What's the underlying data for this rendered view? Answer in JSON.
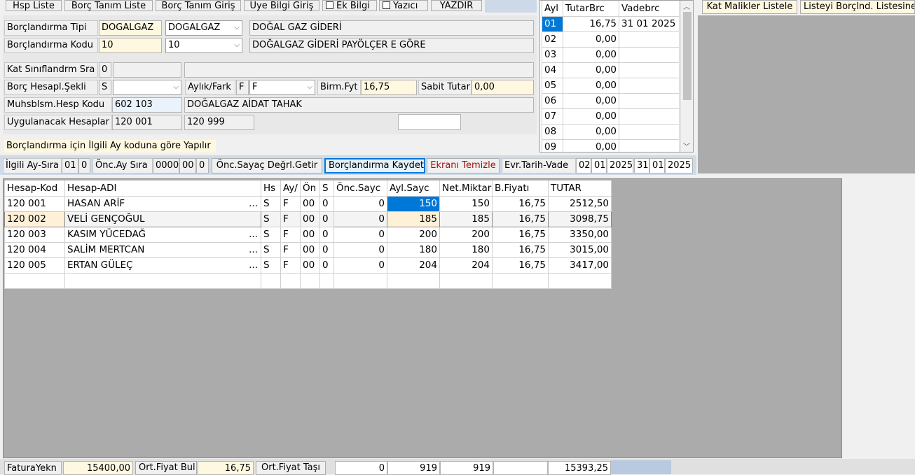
{
  "toolbar": {
    "hsp_liste": "Hsp Liste",
    "borc_tanim_liste": "Borç Tanım Liste",
    "borc_tanim_giris": "Borç Tanım Giriş",
    "uye_bilgi_giris": "Üye Bilgi Giriş",
    "ek_bilgi": "Ek Bilgi",
    "yazici": "Yazıcı",
    "yazdir": "YAZDIR"
  },
  "form": {
    "borc_tipi_label": "Borçlandırma Tipi",
    "borc_tipi_value": "DOGALGAZ",
    "borc_tipi_combo": "DOGALGAZ",
    "borc_tipi_desc": "DOĞAL GAZ GİDERİ",
    "borc_kodu_label": "Borçlandırma Kodu",
    "borc_kodu_value": "10",
    "borc_kodu_combo": "10",
    "borc_kodu_desc": "DOĞALGAZ GİDERİ PAYÖLÇER E GÖRE",
    "kat_sinif_label": "Kat Sınıflandrm Sra",
    "kat_sinif_value": "0",
    "kat_sinif_desc": "",
    "kat_sinif_desc2": "",
    "borc_hesapl_label": "Borç Hesapl.Şekli",
    "borc_hesapl_value": "S",
    "borc_hesapl_combo": "",
    "aylik_fark_label": "Aylık/Fark",
    "aylik_fark_value": "F",
    "aylik_fark_combo": "F",
    "birm_fyt_label": "Birm.Fyt",
    "birm_fyt_value": "16,75",
    "sabit_tutar_label": "Sabit Tutar",
    "sabit_tutar_value": "0,00",
    "muhsb_label": "Muhsblsm.Hesp Kodu",
    "muhsb_value": "602 103",
    "muhsb_desc": "DOĞALGAZ AİDAT TAHAK",
    "uyg_hesap_label": "Uygulanacak Hesaplar",
    "uyg_hesap_from": "120 001",
    "uyg_hesap_to": "120 999",
    "uyg_extra": "",
    "info_text": "Borçlandırma için İlgili Ay koduna göre Yapılır"
  },
  "month_grid": {
    "headers": [
      "Ayl",
      "TutarBrc",
      "Vadebrc"
    ],
    "rows": [
      [
        "01",
        "16,75",
        "31 01 2025"
      ],
      [
        "02",
        "0,00",
        ""
      ],
      [
        "03",
        "0,00",
        ""
      ],
      [
        "04",
        "0,00",
        ""
      ],
      [
        "05",
        "0,00",
        ""
      ],
      [
        "06",
        "0,00",
        ""
      ],
      [
        "07",
        "0,00",
        ""
      ],
      [
        "08",
        "0,00",
        ""
      ],
      [
        "09",
        "0,00",
        ""
      ]
    ]
  },
  "right_buttons": {
    "kat_malikler": "Kat Malikler Listele",
    "listeyi_borclnd": "Listeyi Borçlnd. Listesine"
  },
  "action_bar": {
    "ilgili_ay_label": "İlgili Ay-Sıra",
    "ilgili_ay": "01",
    "ilgili_sira": "0",
    "onc_ay_label": "Önc.Ay Sıra",
    "onc_ay_year": "0000",
    "onc_ay": "00",
    "onc_sira": "0",
    "onc_sayac_btn": "Önc.Sayaç Değrl.Getir",
    "kaydet_btn": "Borçlandırma Kaydet",
    "temizle_btn": "Ekranı Temizle",
    "evr_tarih_label": "Evr.Tarih-Vade",
    "evr_gun": "02",
    "evr_ay": "01",
    "evr_yil": "2025",
    "vade_gun": "31",
    "vade_ay": "01",
    "vade_yil": "2025"
  },
  "main_grid": {
    "headers": [
      "Hesap-Kod",
      "Hesap-ADI",
      "Hs",
      "Ay/",
      "Ön",
      "S",
      "Önc.Sayc",
      "Ayl.Sayc",
      "Net.Miktar",
      "B.Fiyatı",
      "TUTAR"
    ],
    "rows": [
      [
        "120 001",
        "HASAN ARİF",
        "S",
        "F",
        "00",
        "0",
        "0",
        "150",
        "150",
        "16,75",
        "2512,50"
      ],
      [
        "120 002",
        "VELİ GENÇOĞUL",
        "S",
        "F",
        "00",
        "0",
        "0",
        "185",
        "185",
        "16,75",
        "3098,75"
      ],
      [
        "120 003",
        "KASIM YÜCEDAĞ",
        "S",
        "F",
        "00",
        "0",
        "0",
        "200",
        "200",
        "16,75",
        "3350,00"
      ],
      [
        "120 004",
        "SALİM MERTCAN",
        "S",
        "F",
        "00",
        "0",
        "0",
        "180",
        "180",
        "16,75",
        "3015,00"
      ],
      [
        "120 005",
        "ERTAN GÜLEÇ",
        "S",
        "F",
        "00",
        "0",
        "0",
        "204",
        "204",
        "16,75",
        "3417,00"
      ]
    ],
    "ellipsis": "..."
  },
  "bottom": {
    "fatura_label": "FaturaYekn",
    "fatura_value": "15400,00",
    "ort_fiyat_btn": "Ort.Fiyat Bul",
    "ort_fiyat_value": "16,75",
    "ort_fiyat_tasi": "Ort.Fiyat Taşı",
    "sum_onc": "0",
    "sum_ayl": "919",
    "sum_net": "919",
    "sum_bfiyat": "",
    "sum_tutar": "15393,25"
  }
}
